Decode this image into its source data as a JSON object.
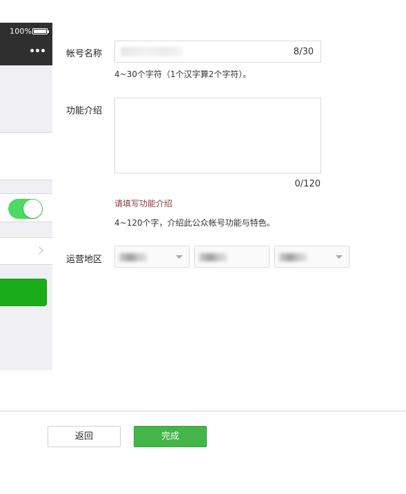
{
  "phone_preview": {
    "battery_text": "100%",
    "more_icon": "more-icon",
    "chevron_icon": "chevron-right-icon",
    "toggle_on": true,
    "colors": {
      "statusbar": "#2f2f2f",
      "toggle": "#4cd964",
      "button": "#1aad19"
    }
  },
  "form": {
    "name": {
      "label": "帐号名称",
      "counter": "8/30",
      "hint": "4~30个字符（1个汉字算2个字符）。"
    },
    "intro": {
      "label": "功能介绍",
      "counter": "0/120",
      "error": "请填写功能介绍",
      "hint": "4~120个字，介绍此公众帐号功能与特色。"
    },
    "region": {
      "label": "运营地区",
      "selects": [
        {
          "caret_icon": "caret-down-icon"
        },
        {
          "caret_icon": null
        },
        {
          "caret_icon": "caret-down-icon"
        }
      ]
    }
  },
  "footer": {
    "back_label": "返回",
    "done_label": "完成",
    "colors": {
      "done": "#44b549"
    }
  }
}
